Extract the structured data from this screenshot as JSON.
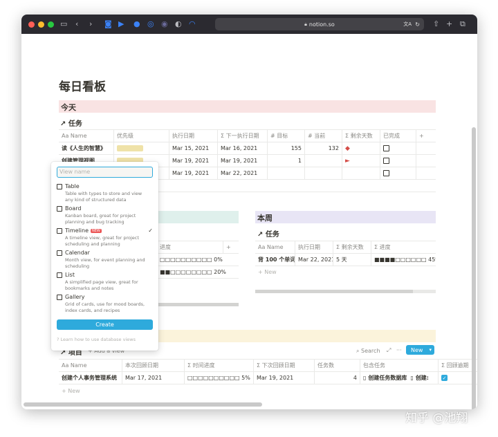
{
  "browser": {
    "url": "notion.so",
    "colors": {
      "close": "#ff5f57",
      "minimize": "#febc2e",
      "zoom": "#28c840"
    },
    "icons": [
      "sidebar-icon",
      "back-icon",
      "forward-icon",
      "pocket-icon",
      "ext-icon",
      "ext-icon",
      "ext-icon",
      "ext-icon",
      "shield-icon",
      "rss-icon",
      "lock-icon",
      "translate-icon",
      "reload-icon",
      "share-icon",
      "plus-icon",
      "tabs-icon"
    ]
  },
  "page": {
    "title": "每日看板"
  },
  "today": {
    "heading": "今天",
    "heading_color": "#f9e3e3",
    "db_title": "↗ 任务",
    "columns": [
      "Aa Name",
      "优先级",
      "执行日期",
      "Σ 下一执行日期",
      "# 目标",
      "# 当前",
      "Σ 剩余天数",
      "已完成",
      "+"
    ],
    "rows": [
      {
        "name": "读《人生的智慧》",
        "priority": "★★★",
        "date": "Mar 15, 2021",
        "next": "Mar 16, 2021",
        "goal": "155",
        "current": "132",
        "remaining": "",
        "done": false
      },
      {
        "name": "创建管理视图",
        "priority": "★★★",
        "date": "Mar 19, 2021",
        "next": "Mar 19, 2021",
        "goal": "1",
        "current": "",
        "remaining": "",
        "done": false
      },
      {
        "name": "",
        "priority": "",
        "date": "Mar 19, 2021",
        "next": "Mar 22, 2021",
        "goal": "",
        "current": "",
        "remaining": "",
        "done": false
      }
    ]
  },
  "left_week": {
    "heading_color": "#dff0ec",
    "columns": [
      "进度",
      "+"
    ],
    "rows": [
      {
        "progress": "□□□□□□□□□□ 0%"
      },
      {
        "progress": "■■□□□□□□□□ 20%"
      }
    ]
  },
  "this_week": {
    "heading": "本周",
    "heading_color": "#e8e5f5",
    "db_title": "↗ 任务",
    "columns": [
      "Aa Name",
      "执行日期",
      "Σ 剩余天数",
      "Σ 进度"
    ],
    "rows": [
      {
        "name": "背 100 个单词",
        "date": "Mar 22, 2021",
        "remaining": "5 天",
        "progress": "■■■■□□□□□□ 45%"
      }
    ],
    "new_label": "+ New"
  },
  "projects": {
    "heading_color": "#fbf3db",
    "db_title": "↗ 项目",
    "add_view": "+ Add a view",
    "search": "Search",
    "more": "···",
    "new_button": "New",
    "columns": [
      "Aa Name",
      "本次回顾日期",
      "Σ 时间进度",
      "Σ 下次回顾日期",
      "任务数",
      "包含任务",
      "Σ 回顾逾期"
    ],
    "rows": [
      {
        "name": "创建个人事务管理系统",
        "review": "Mar 17, 2021",
        "progress": "□□□□□□□□□□ 5%",
        "next_review": "Mar 19, 2021",
        "count": "4",
        "tasks": "创建任务数据库",
        "tasks2": "创建:",
        "overdue": true
      }
    ],
    "new_label": "+ New"
  },
  "view_menu": {
    "placeholder": "View name",
    "options": [
      {
        "label": "Table",
        "desc": "Table with types to store and view any kind of structured data",
        "icon": "table-icon",
        "selected": false,
        "new": false
      },
      {
        "label": "Board",
        "desc": "Kanban board, great for project planning and bug tracking",
        "icon": "board-icon",
        "selected": false,
        "new": false
      },
      {
        "label": "Timeline",
        "desc": "A timeline view, great for project scheduling and planning",
        "icon": "timeline-icon",
        "selected": true,
        "new": true
      },
      {
        "label": "Calendar",
        "desc": "Month view, for event planning and scheduling",
        "icon": "calendar-icon",
        "selected": false,
        "new": false
      },
      {
        "label": "List",
        "desc": "A simplified page view, great for bookmarks and notes",
        "icon": "list-icon",
        "selected": false,
        "new": false
      },
      {
        "label": "Gallery",
        "desc": "Grid of cards, use for mood boards, index cards, and recipes",
        "icon": "gallery-icon",
        "selected": false,
        "new": false
      }
    ],
    "new_badge": "NEW",
    "create_label": "Create",
    "footer": "Learn how to use database views"
  },
  "watermark": "知乎 @池翔"
}
